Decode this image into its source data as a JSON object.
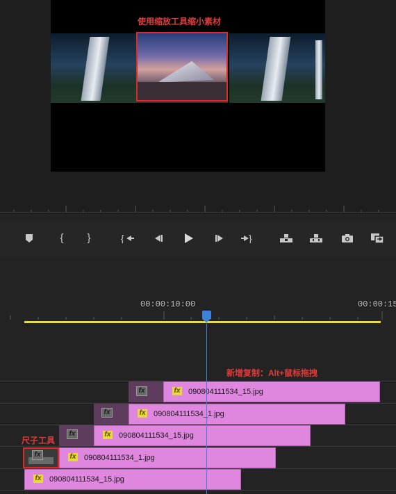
{
  "monitor": {
    "caption": "使用缩放工具缩小素材"
  },
  "transport": {
    "buttons": [
      {
        "icon": "add-marker-icon"
      },
      {
        "icon": "mark-in-icon"
      },
      {
        "icon": "mark-out-icon"
      },
      {
        "icon": "go-to-in-icon"
      },
      {
        "icon": "step-back-icon"
      },
      {
        "icon": "play-icon"
      },
      {
        "icon": "step-forward-icon"
      },
      {
        "icon": "go-to-out-icon"
      },
      {
        "icon": "lift-icon"
      },
      {
        "icon": "extract-icon"
      },
      {
        "icon": "export-frame-icon"
      },
      {
        "icon": "compare-view-icon"
      }
    ]
  },
  "timeline": {
    "timecodes": [
      "00:00:10:00",
      "00:00:15:"
    ],
    "dup_caption": "新增复制：Alt+鼠标拖拽",
    "ruler_caption": "尺子工具",
    "fx_label": "fx",
    "clips": [
      {
        "name": "090804111534_15.jpg"
      },
      {
        "name": "090804111534_1.jpg"
      },
      {
        "name": "090804111534_15.jpg"
      },
      {
        "name": "090804111534_1.jpg"
      },
      {
        "name": "090804111534_15.jpg"
      }
    ]
  },
  "colors": {
    "annotation": "#e03a3a",
    "clip": "#df86df",
    "playhead": "#3c82d8",
    "work_area": "#e8e02c"
  }
}
